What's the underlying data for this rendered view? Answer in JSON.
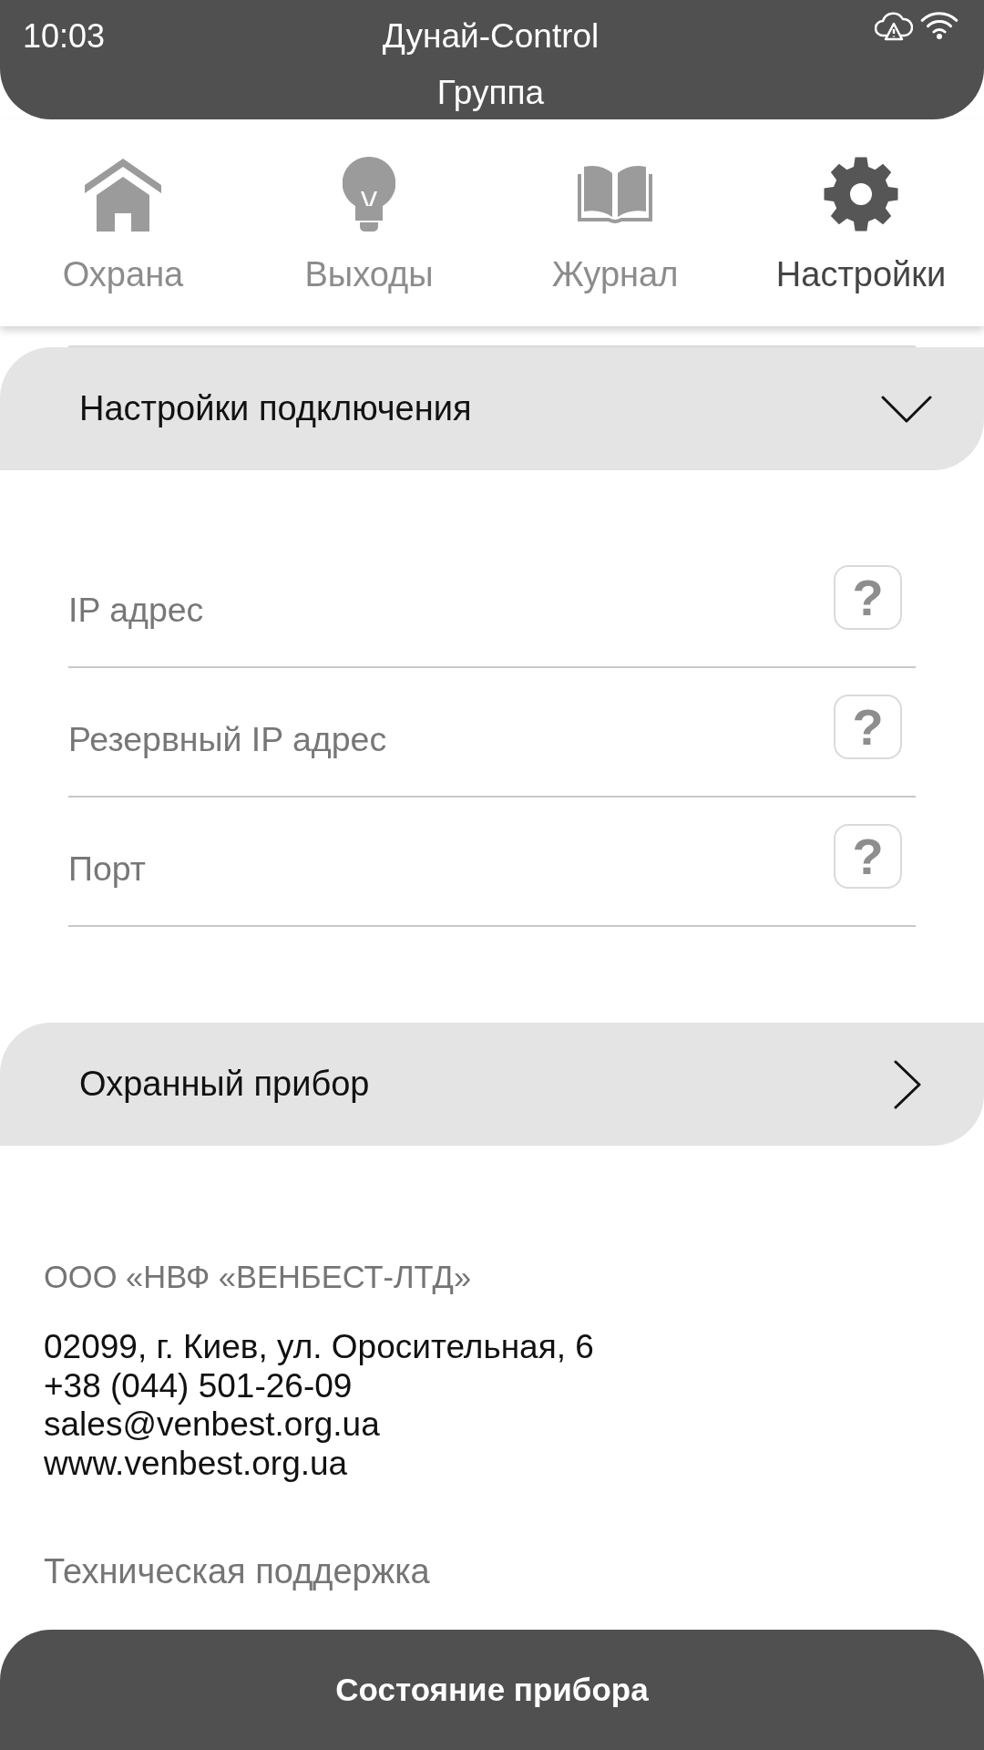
{
  "status_bar": {
    "time": "10:03"
  },
  "header": {
    "title": "Дунай-Control",
    "subtitle": "Группа"
  },
  "tabs": [
    {
      "label": "Охрана",
      "selected": false
    },
    {
      "label": "Выходы",
      "selected": false
    },
    {
      "label": "Журнал",
      "selected": false
    },
    {
      "label": "Настройки",
      "selected": true
    }
  ],
  "sections": [
    {
      "title": "Настройки подключения",
      "expanded": true,
      "fields": [
        {
          "placeholder": "IP адрес",
          "help": "?"
        },
        {
          "placeholder": "Резервный IP адрес",
          "help": "?"
        },
        {
          "placeholder": "Порт",
          "help": "?"
        }
      ]
    },
    {
      "title": "Охранный прибор",
      "expanded": false
    }
  ],
  "company": {
    "name": "ООО «НВФ «ВЕНБЕСТ-ЛТД»",
    "contacts": [
      "02099, г. Киев, ул. Оросительная, 6",
      "+38 (044) 501-26-09",
      "sales@venbest.org.ua",
      "www.venbest.org.ua"
    ]
  },
  "support": {
    "title": "Техническая поддержка"
  },
  "bottom_button": {
    "label": "Состояние прибора"
  }
}
